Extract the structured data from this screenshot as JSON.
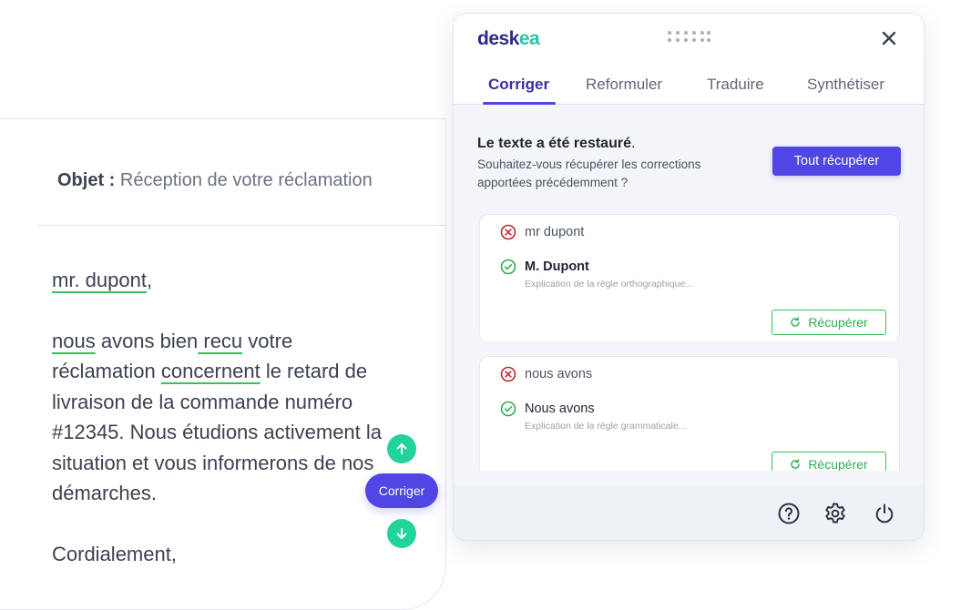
{
  "editor": {
    "subject_label": "Objet :",
    "subject_value": "Réception de votre réclamation",
    "greeting_error": "mr. dupont",
    "greeting_rest": ",",
    "para_w1": "nous",
    "para_t1": " avons bien",
    "para_w2": " recu",
    "para_t2": " votre réclamation ",
    "para_w3": "concernent",
    "para_t3": " le retard de livraison de la commande numéro #12345. Nous étudions activement la situation et vous informerons de nos démarches.",
    "closing": "Cordialement,",
    "float_button": "Corriger"
  },
  "panel": {
    "logo_a": "desk",
    "logo_b": "ea",
    "tabs": [
      "Corriger",
      "Reformuler",
      "Traduire",
      "Synthétiser"
    ],
    "restore_title_bold": "Le texte a été restauré",
    "restore_title_end": ".",
    "restore_question": "Souhaitez-vous récupérer les corrections apportées précédemment ?",
    "restore_all_button": "Tout récupérer",
    "suggestions": [
      {
        "original": "mr dupont",
        "correction": "M. Dupont",
        "explanation": "Explication de la règle orthographique...",
        "action": "Récupérer"
      },
      {
        "original": "nous avons",
        "correction": "Nous avons",
        "explanation": "Explication de la règle grammaticale...",
        "action": "Récupérer"
      }
    ]
  },
  "colors": {
    "brand": "#4f46e5",
    "accent_teal": "#22d39e",
    "success": "#35c25a",
    "error": "#c0262d"
  }
}
